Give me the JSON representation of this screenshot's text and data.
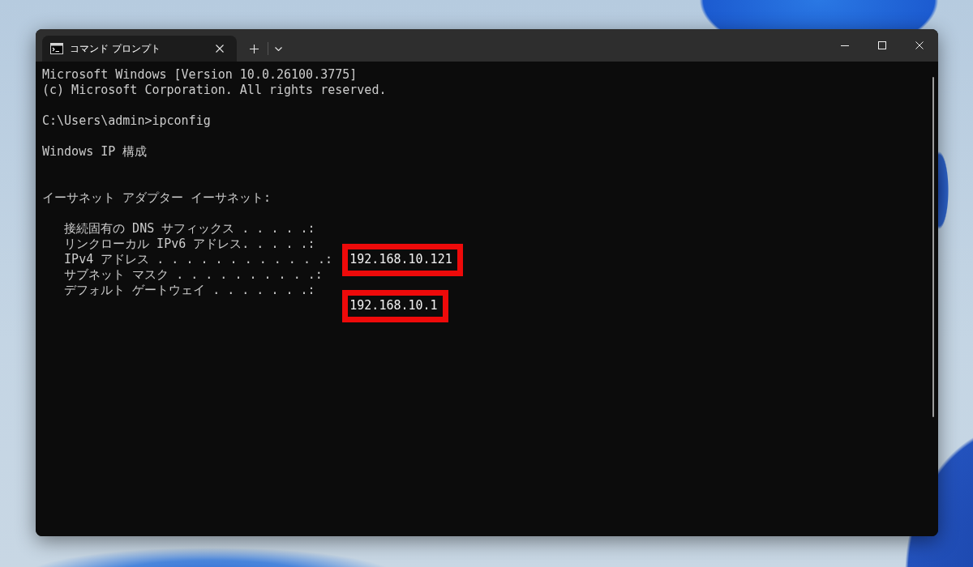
{
  "window": {
    "tabs": [
      {
        "title": "コマンド プロンプト",
        "selected": true
      }
    ]
  },
  "terminal": {
    "lines": [
      {
        "kind": "text",
        "text": "Microsoft Windows [Version 10.0.26100.3775]"
      },
      {
        "kind": "text",
        "text": "(c) Microsoft Corporation. All rights reserved."
      },
      {
        "kind": "blank"
      },
      {
        "kind": "text",
        "text": "C:\\Users\\admin>ipconfig"
      },
      {
        "kind": "blank"
      },
      {
        "kind": "text",
        "text": "Windows IP 構成"
      },
      {
        "kind": "blank"
      },
      {
        "kind": "blank"
      },
      {
        "kind": "text",
        "text": "イーサネット アダプター イーサネット:"
      },
      {
        "kind": "blank"
      },
      {
        "kind": "field",
        "label": "接続固有の DNS サフィックス . . . . .:"
      },
      {
        "kind": "field",
        "label": "リンクローカル IPv6 アドレス. . . . .:"
      },
      {
        "kind": "field",
        "label": "IPv4 アドレス . . . . . . . . . . . .:",
        "value": "192.168.10.121",
        "highlighted": true
      },
      {
        "kind": "field",
        "label": "サブネット マスク . . . . . . . . . .:"
      },
      {
        "kind": "field",
        "label": "デフォルト ゲートウェイ . . . . . . .:"
      },
      {
        "kind": "continuation",
        "value": "192.168.10.1",
        "highlighted": true
      }
    ]
  }
}
